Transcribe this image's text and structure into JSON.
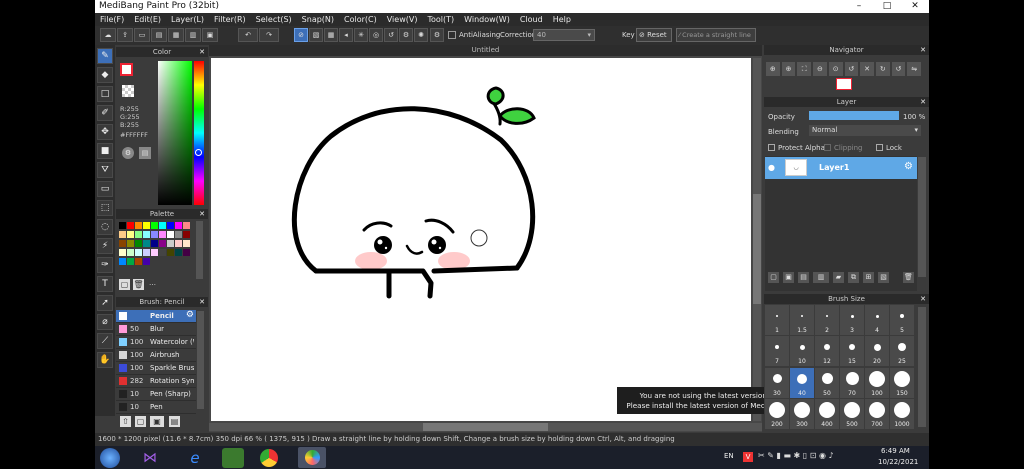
{
  "window": {
    "title": "MediBang Paint Pro (32bit)",
    "min": "–",
    "max": "□",
    "close": "✕"
  },
  "menu": [
    "File(F)",
    "Edit(E)",
    "Layer(L)",
    "Filter(R)",
    "Select(S)",
    "Snap(N)",
    "Color(C)",
    "View(V)",
    "Tool(T)",
    "Window(W)",
    "Cloud",
    "Help"
  ],
  "toolbar": {
    "antialiasing_label": "AntiAliasing",
    "correction_label": "Correction",
    "correction_value": "40",
    "key_label": "Key",
    "reset_label": "Reset",
    "straight_line_label": "Create a straight line"
  },
  "color_panel": {
    "title": "Color",
    "rgb": [
      "R:255",
      "G:255",
      "B:255"
    ],
    "hex": "#FFFFFF",
    "main_color": "#ffffff"
  },
  "palette_panel": {
    "title": "Palette",
    "swatches": [
      "#000000",
      "#ff0000",
      "#ff8800",
      "#ffff00",
      "#00ff00",
      "#00ffff",
      "#0000ff",
      "#ff00ff",
      "#ff8888",
      "#ffcc88",
      "#ffff88",
      "#88ff88",
      "#88ffff",
      "#8888ff",
      "#ff88ff",
      "#ffffff",
      "#888888",
      "#880000",
      "#884400",
      "#888800",
      "#008800",
      "#008888",
      "#000088",
      "#880088",
      "#cccccc",
      "#ffcccc",
      "#ffe6cc",
      "#ffffcc",
      "#ccffcc",
      "#ccffff",
      "#ccccff",
      "#ffccff",
      "#444444",
      "#444400",
      "#004444",
      "#440044",
      "#0088ff",
      "#00aa44",
      "#aa4400",
      "#4400aa"
    ],
    "more_label": "…"
  },
  "brush_panel": {
    "title": "Brush: Pencil",
    "brushes": [
      {
        "size": "",
        "name": "Pencil",
        "color": "#ffffff",
        "selected": true
      },
      {
        "size": "50",
        "name": "Blur",
        "color": "#ff9ad8",
        "selected": false
      },
      {
        "size": "100",
        "name": "Watercolor (W",
        "color": "#7fd0ff",
        "selected": false
      },
      {
        "size": "100",
        "name": "Airbrush",
        "color": "#d8d8d8",
        "selected": false
      },
      {
        "size": "100",
        "name": "Sparkle Brush",
        "color": "#3b4bd8",
        "selected": false
      },
      {
        "size": "282",
        "name": "Rotation Sym",
        "color": "#e03030",
        "selected": false
      },
      {
        "size": "10",
        "name": "Pen (Sharp)",
        "color": "#222222",
        "selected": false
      },
      {
        "size": "10",
        "name": "Pen",
        "color": "#222222",
        "selected": false
      }
    ]
  },
  "document": {
    "tab": "Untitled"
  },
  "notice": {
    "line1": "You are not using the latest version of MediBang Paint.",
    "line2": "Please install the latest version of MediBang Paint found here."
  },
  "navigator": {
    "title": "Navigator"
  },
  "layer_panel": {
    "title": "Layer",
    "opacity_label": "Opacity",
    "opacity_value": "100 %",
    "opacity_fraction": 1.0,
    "blending_label": "Blending",
    "blending_value": "Normal",
    "protect_alpha": "Protect Alpha",
    "clipping": "Clipping",
    "lock": "Lock",
    "layers": [
      {
        "name": "Layer1"
      }
    ]
  },
  "brush_size_panel": {
    "title": "Brush Size",
    "sizes": [
      "1",
      "1.5",
      "2",
      "3",
      "4",
      "5",
      "7",
      "10",
      "12",
      "15",
      "20",
      "25",
      "30",
      "40",
      "50",
      "70",
      "100",
      "150",
      "200",
      "300",
      "400",
      "500",
      "700",
      "1000"
    ],
    "selected": "40"
  },
  "status": {
    "text": "1600 * 1200 pixel  (11.6 * 8.7cm)  350 dpi  66 %  ( 1375, 915 )  Draw a straight line by holding down Shift, Change a brush size by holding down Ctrl, Alt, and dragging"
  },
  "taskbar": {
    "lang": "EN",
    "time": "6:49 AM",
    "date": "10/22/2021"
  },
  "colors": {
    "accent": "#3d6fb8",
    "panel": "#3b3b3b",
    "leaf": "#3fd23f",
    "blush": "#ffb7b7"
  }
}
